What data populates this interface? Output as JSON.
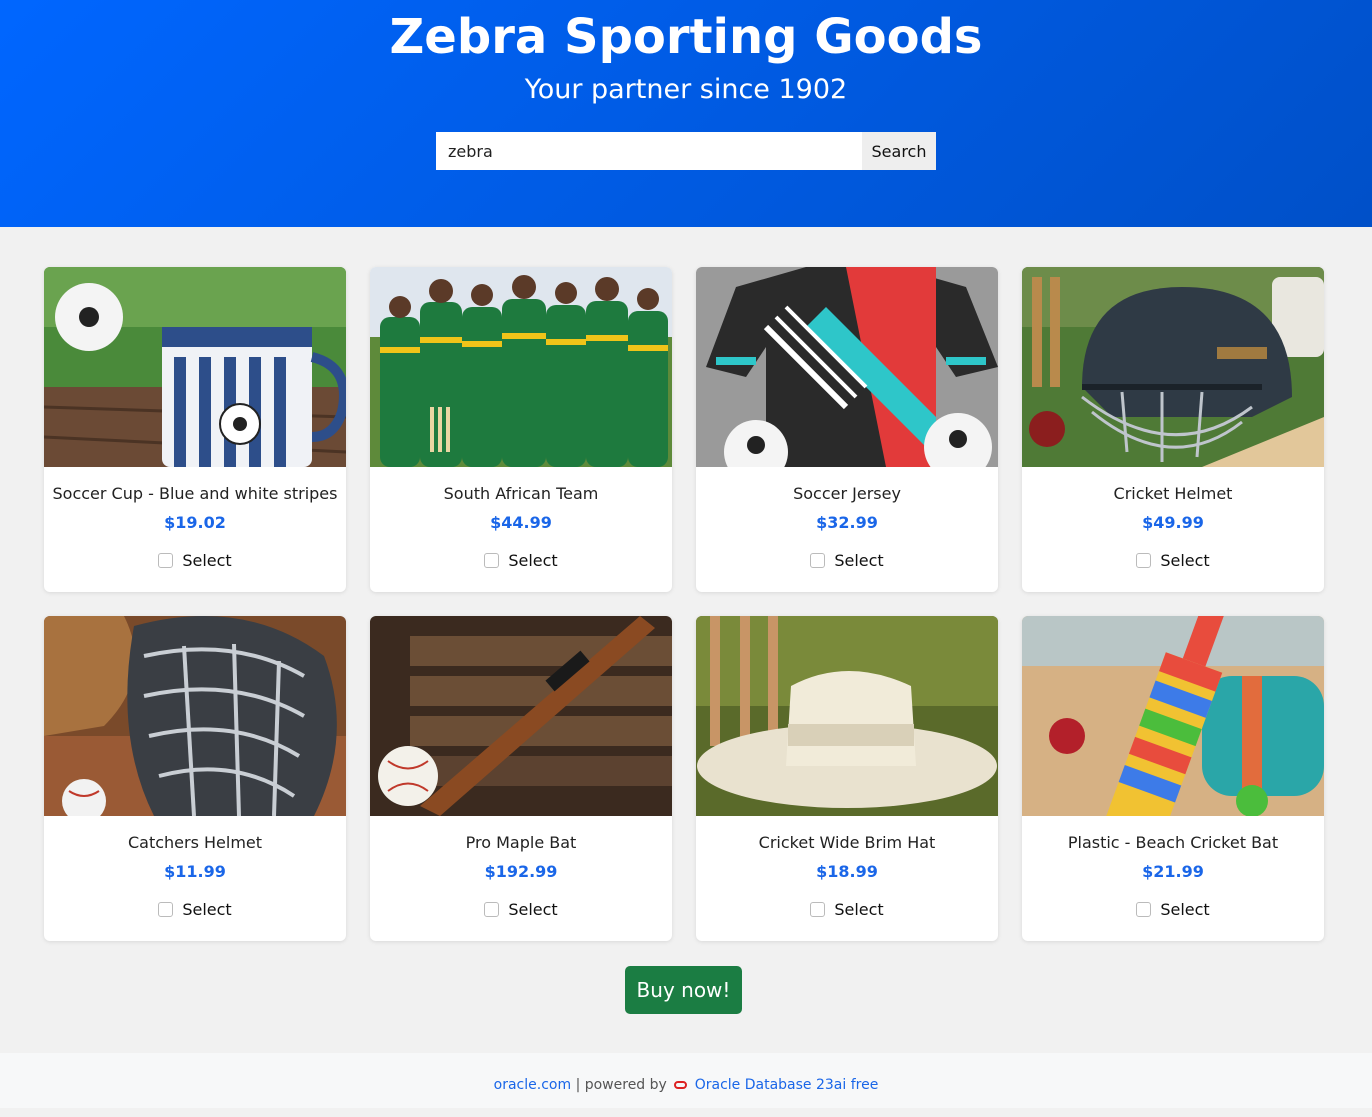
{
  "header": {
    "title": "Zebra Sporting Goods",
    "subtitle": "Your partner since 1902",
    "search_value": "zebra",
    "search_button": "Search"
  },
  "products": [
    {
      "name": "Soccer Cup - Blue and white stripes",
      "price": "$19.02",
      "select_label": "Select",
      "image_icon": "mug-image"
    },
    {
      "name": "South African Team",
      "price": "$44.99",
      "select_label": "Select",
      "image_icon": "team-image"
    },
    {
      "name": "Soccer Jersey",
      "price": "$32.99",
      "select_label": "Select",
      "image_icon": "jersey-image"
    },
    {
      "name": "Cricket Helmet",
      "price": "$49.99",
      "select_label": "Select",
      "image_icon": "helmet-image"
    },
    {
      "name": "Catchers Helmet",
      "price": "$11.99",
      "select_label": "Select",
      "image_icon": "catchers-helmet-image"
    },
    {
      "name": "Pro Maple Bat",
      "price": "$192.99",
      "select_label": "Select",
      "image_icon": "bat-image"
    },
    {
      "name": "Cricket Wide Brim Hat",
      "price": "$18.99",
      "select_label": "Select",
      "image_icon": "hat-image"
    },
    {
      "name": "Plastic - Beach Cricket Bat",
      "price": "$21.99",
      "select_label": "Select",
      "image_icon": "beach-bat-image"
    }
  ],
  "buy_button": "Buy now!",
  "footer": {
    "link1": "oracle.com",
    "separator": "| powered by",
    "link2": "Oracle Database 23ai free"
  },
  "colors": {
    "header_blue": "#0066ff",
    "price_blue": "#1a66e8",
    "buy_green": "#1b7d43"
  }
}
